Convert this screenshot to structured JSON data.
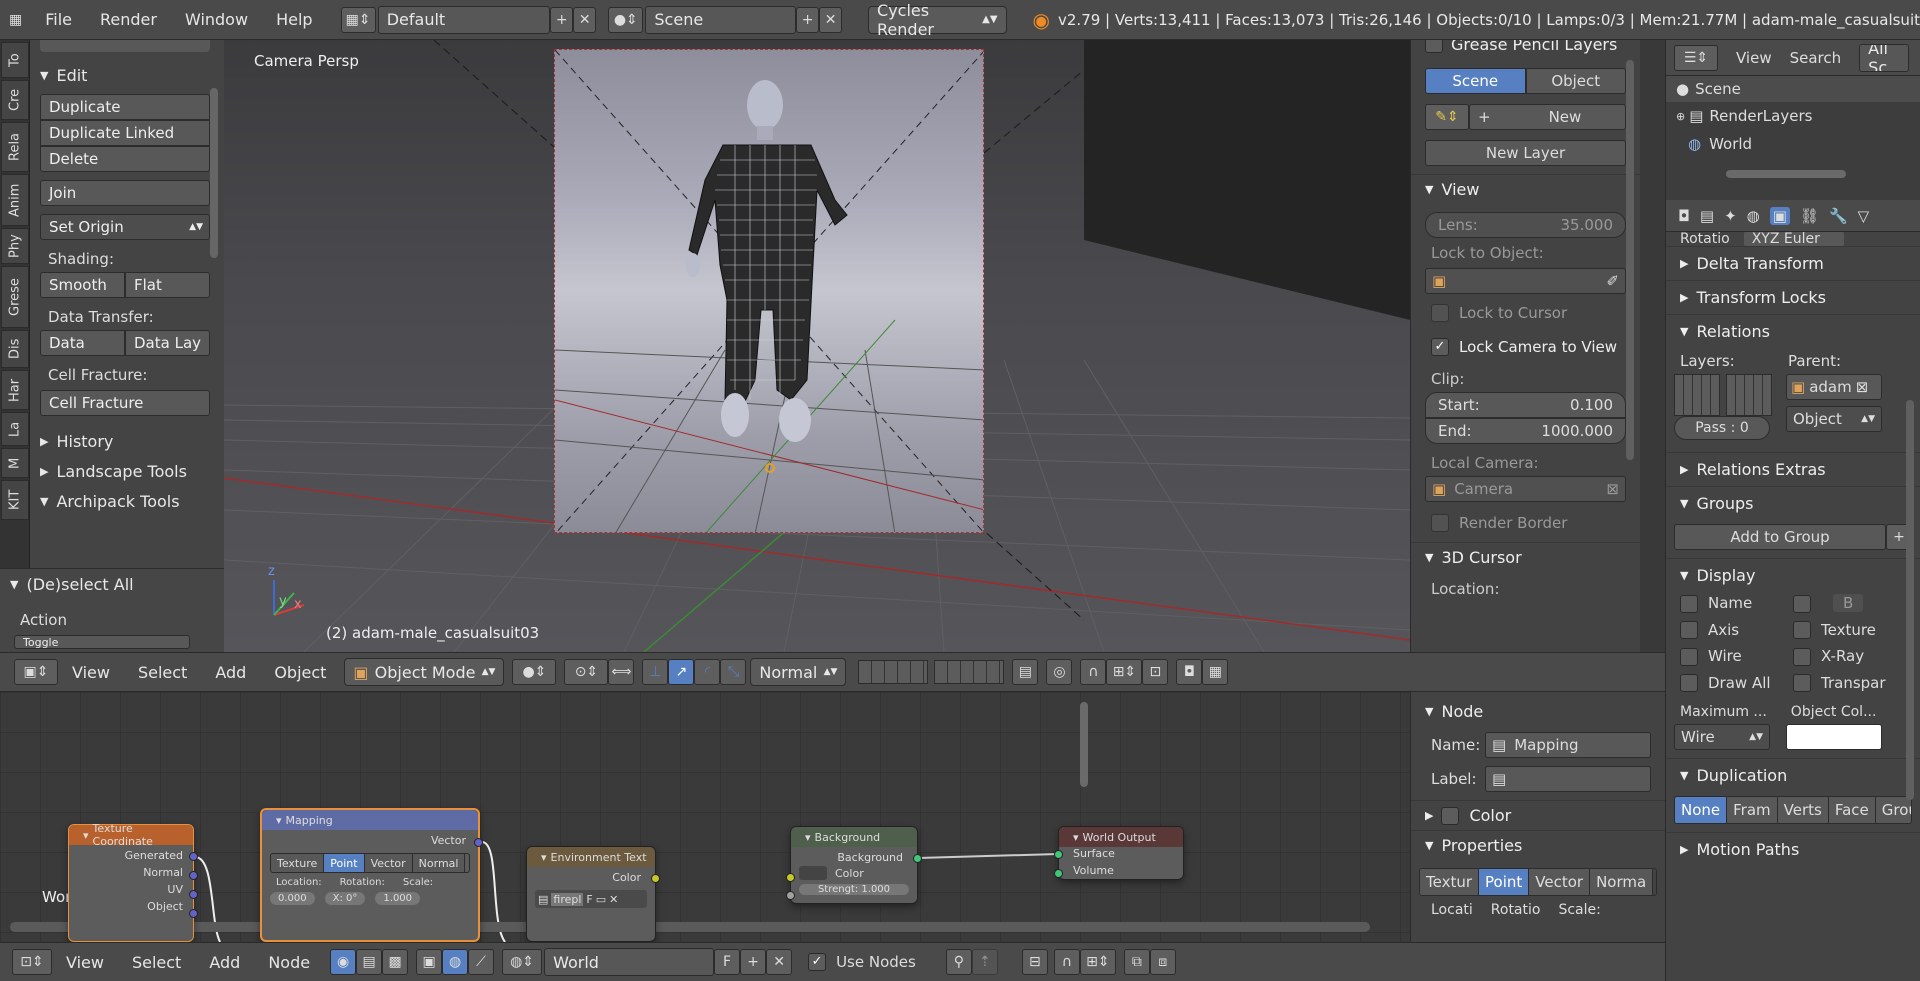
{
  "topbar": {
    "menus": [
      "File",
      "Render",
      "Window",
      "Help"
    ],
    "screen_layout": "Default",
    "scene": "Scene",
    "engine": "Cycles Render",
    "stats": "v2.79 | Verts:13,411 | Faces:13,073 | Tris:26,146 | Objects:0/10 | Lamps:0/3 | Mem:21.77M | adam-male_casualsuit"
  },
  "tabs": [
    "To",
    "Cre",
    "Rela",
    "Anim",
    "Phy",
    "Grese",
    "Dis",
    "Har",
    "La",
    "M",
    "KIT"
  ],
  "shelf": {
    "edit_title": "Edit",
    "buttons": [
      "Duplicate",
      "Duplicate Linked",
      "Delete"
    ],
    "join": "Join",
    "set_origin": "Set Origin",
    "shading_label": "Shading:",
    "smooth": "Smooth",
    "flat": "Flat",
    "data_transfer_label": "Data Transfer:",
    "data": "Data",
    "data_lay": "Data Lay",
    "cell_fracture_label": "Cell Fracture:",
    "cell_fracture": "Cell Fracture",
    "history": "History",
    "landscape": "Landscape Tools",
    "archipack": "Archipack Tools",
    "deselect": "(De)select All",
    "action": "Action",
    "action_value": "Toggle"
  },
  "viewport": {
    "label": "Camera Persp",
    "object_name": "(2) adam-male_casualsuit03",
    "axis_x": "x",
    "axis_y": "y",
    "axis_z": "z"
  },
  "npanel": {
    "grease_title": "Grease Pencil Layers",
    "scene_tab": "Scene",
    "object_tab": "Object",
    "new": "New",
    "new_layer": "New Layer",
    "view_title": "View",
    "lens_label": "Lens:",
    "lens_value": "35.000",
    "lock_object": "Lock to Object:",
    "lock_cursor": "Lock to Cursor",
    "lock_camera": "Lock Camera to View",
    "clip": "Clip:",
    "start_label": "Start:",
    "start_value": "0.100",
    "end_label": "End:",
    "end_value": "1000.000",
    "local_camera": "Local Camera:",
    "camera": "Camera",
    "render_border": "Render Border",
    "cursor_title": "3D Cursor",
    "location": "Location:"
  },
  "outliner": {
    "view": "View",
    "search": "Search",
    "all": "All Sc",
    "items": [
      "Scene",
      "RenderLayers",
      "World"
    ]
  },
  "props": {
    "rotation_label": "Rotatio",
    "rotation_mode": "XYZ Euler",
    "delta": "Delta Transform",
    "locks": "Transform Locks",
    "relations": "Relations",
    "layers": "Layers:",
    "parent": "Parent:",
    "parent_value": "adam",
    "parent_type": "Object",
    "pass": "Pass : 0",
    "relations_extras": "Relations Extras",
    "groups": "Groups",
    "add_to_group": "Add to Group",
    "display": "Display",
    "name": "Name",
    "axis": "Axis",
    "wire": "Wire",
    "draw_all": "Draw All",
    "b": "B",
    "texture": "Texture",
    "xray": "X-Ray",
    "transpar": "Transpar",
    "maximum": "Maximum ...",
    "object_col": "Object Col...",
    "wire_value": "Wire",
    "duplication": "Duplication",
    "dup_tabs": [
      "None",
      "Fram",
      "Verts",
      "Face",
      "Grou"
    ],
    "motion": "Motion Paths"
  },
  "vheader": {
    "view": "View",
    "select": "Select",
    "add": "Add",
    "object": "Object",
    "mode": "Object Mode",
    "pivot": "Normal"
  },
  "nodes": {
    "texcoord": {
      "title": "Texture Coordinate",
      "outputs": [
        "Generated",
        "Normal",
        "UV",
        "Object"
      ]
    },
    "mapping": {
      "title": "Mapping",
      "output": "Vector",
      "tabs": [
        "Texture",
        "Point",
        "Vector",
        "Normal"
      ],
      "location": "Location:",
      "rotation": "Rotation:",
      "scale": "Scale:",
      "loc_x": "0.000",
      "rot_x": "X: 0°",
      "scale_x": "1.000"
    },
    "envtex": {
      "title": "Environment Text",
      "output": "Color",
      "image": "firepl"
    },
    "background": {
      "title": "Background",
      "output": "Background",
      "color": "Color",
      "strength": "Strengt: 1.000"
    },
    "output": {
      "title": "World Output",
      "surface": "Surface",
      "volume": "Volume"
    },
    "world_label": "World"
  },
  "nodepanel": {
    "node_title": "Node",
    "name_label": "Name:",
    "name_value": "Mapping",
    "label_label": "Label:",
    "color": "Color",
    "properties": "Properties",
    "tabs": [
      "Textur",
      "Point",
      "Vector",
      "Norma"
    ],
    "cols": [
      "Locati",
      "Rotatio",
      "Scale:"
    ]
  },
  "bottombar": {
    "view": "View",
    "select": "Select",
    "add": "Add",
    "node": "Node",
    "world": "World",
    "f": "F",
    "use_nodes": "Use Nodes"
  }
}
